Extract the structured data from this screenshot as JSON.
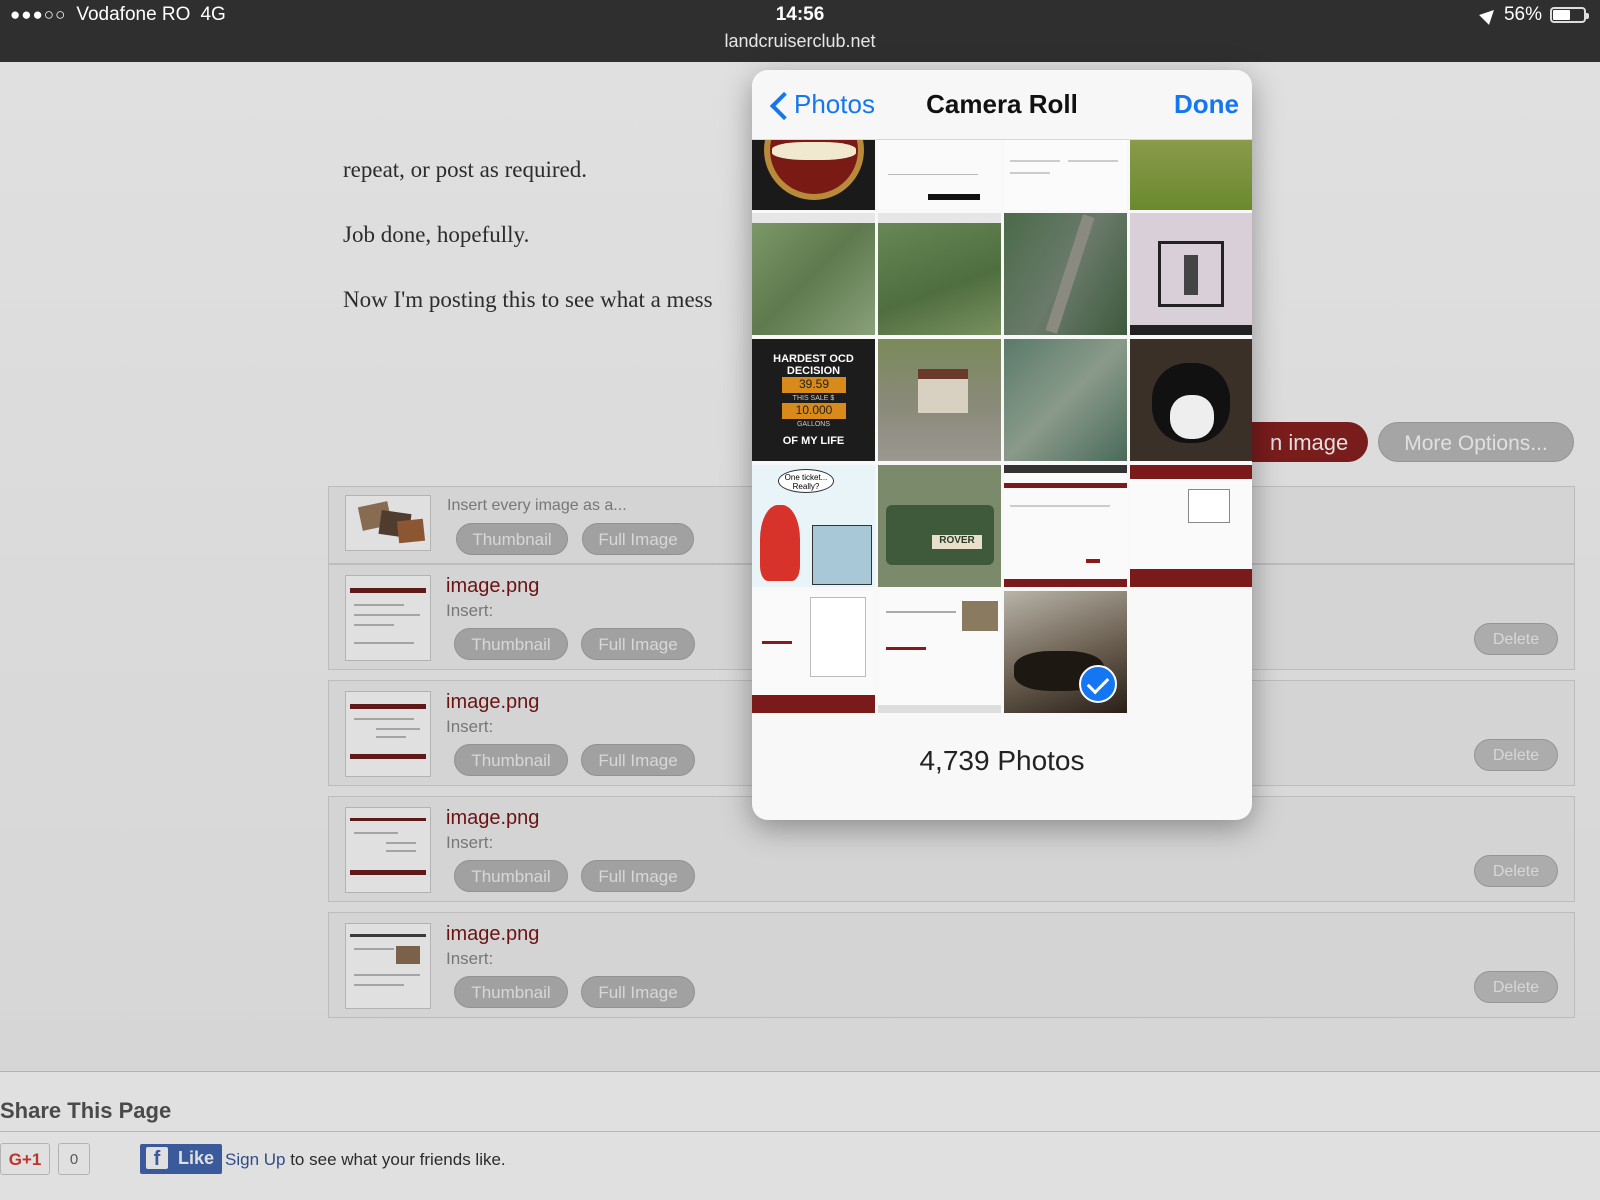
{
  "status_bar": {
    "carrier": "Vodafone RO",
    "network": "4G",
    "time": "14:56",
    "url": "landcruiserclub.net",
    "battery": "56%",
    "battery_level": 0.56
  },
  "post": {
    "lines": [
      "repeat, or post as required.",
      "Job done, hopefully.",
      "Now I'm posting this to see what a mess"
    ]
  },
  "toolbar": {
    "upload_label": "n image",
    "more_options_label": "More Options..."
  },
  "attachments": {
    "insert_every_label": "Insert every image as a...",
    "thumbnail_label": "Thumbnail",
    "full_image_label": "Full Image",
    "insert_label": "Insert:",
    "delete_label": "Delete",
    "items": [
      {
        "name": "image.png"
      },
      {
        "name": "image.png"
      },
      {
        "name": "image.png"
      },
      {
        "name": "image.png"
      }
    ]
  },
  "share": {
    "title": "Share This Page",
    "gplus_label": "G+1",
    "gplus_count": "0",
    "fb_like": "Like",
    "fb_signup": "Sign Up",
    "fb_text": " to see what your friends like."
  },
  "picker": {
    "back_label": "Photos",
    "title": "Camera Roll",
    "done_label": "Done",
    "photo_count": "4,739 Photos",
    "meme_top": "HARDEST OCD DECISION",
    "meme_num1": "39.59",
    "meme_mid": "THIS SALE $",
    "meme_num2": "10.000",
    "meme_unit": "GALLONS",
    "meme_bottom": "OF MY LIFE",
    "comic_bubble": "One ticket... Really?",
    "truck_text": "ROVER"
  },
  "colors": {
    "ios_blue": "#1576f2",
    "site_red": "#7a1515",
    "status_bar": "#2f2f2f"
  }
}
